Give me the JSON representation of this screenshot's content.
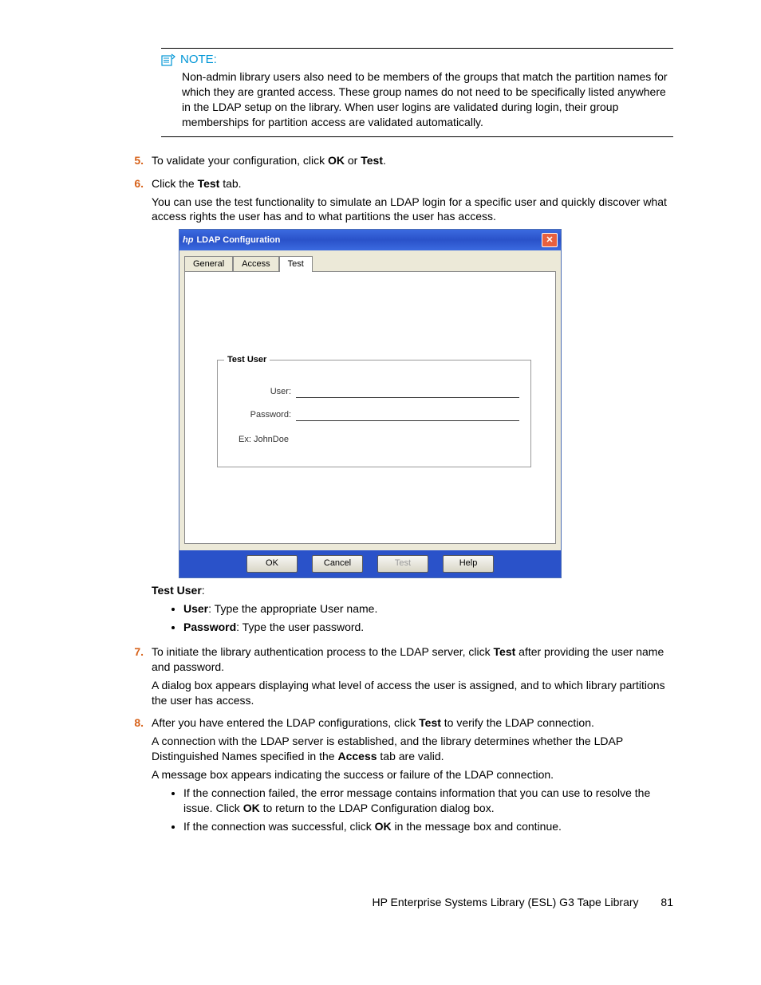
{
  "note": {
    "label": "NOTE:",
    "text": "Non-admin library users also need to be members of the groups that match the partition names for which they are granted access. These group names do not need to be specifically listed anywhere in the LDAP setup on the library. When user logins are validated during login, their group memberships for partition access are validated automatically."
  },
  "steps": {
    "s5": {
      "num": "5.",
      "pre": "To validate your configuration, click ",
      "b1": "OK",
      "mid": " or ",
      "b2": "Test",
      "post": "."
    },
    "s6": {
      "num": "6.",
      "line1_pre": "Click the ",
      "line1_b": "Test",
      "line1_post": " tab.",
      "line2": "You can use the test functionality to simulate an LDAP login for a specific user and quickly discover what access rights the user has and to what partitions the user has access.",
      "testuser_label": "Test User",
      "testuser_colon": ":",
      "bullet1_b": "User",
      "bullet1_rest": ": Type the appropriate User name.",
      "bullet2_b": "Password",
      "bullet2_rest": ": Type the user password."
    },
    "s7": {
      "num": "7.",
      "line1_pre": "To initiate the library authentication process to the LDAP server, click ",
      "line1_b": "Test",
      "line1_post": " after providing the user name and password.",
      "line2": "A dialog box appears displaying what level of access the user is assigned, and to which library partitions the user has access."
    },
    "s8": {
      "num": "8.",
      "line1_pre": "After you have entered the LDAP configurations, click ",
      "line1_b": "Test",
      "line1_post": " to verify the LDAP connection.",
      "line2_pre": "A connection with the LDAP server is established, and the library determines whether the LDAP Distinguished Names specified in the ",
      "line2_b": "Access",
      "line2_post": " tab are valid.",
      "line3": "A message box appears indicating the success or failure of the LDAP connection.",
      "bullet1_pre": "If the connection failed, the error message contains information that you can use to resolve the issue. Click ",
      "bullet1_b": "OK",
      "bullet1_post": " to return to the LDAP Configuration dialog box.",
      "bullet2_pre": "If the connection was successful, click ",
      "bullet2_b": "OK",
      "bullet2_post": " in the message box and continue."
    }
  },
  "dialog": {
    "title": "LDAP Configuration",
    "tabs": {
      "general": "General",
      "access": "Access",
      "test": "Test"
    },
    "legend": "Test User",
    "user_label": "User:",
    "password_label": "Password:",
    "example": "Ex: JohnDoe",
    "buttons": {
      "ok": "OK",
      "cancel": "Cancel",
      "test": "Test",
      "help": "Help"
    }
  },
  "footer": {
    "text": "HP Enterprise Systems Library (ESL) G3 Tape Library",
    "page": "81"
  }
}
